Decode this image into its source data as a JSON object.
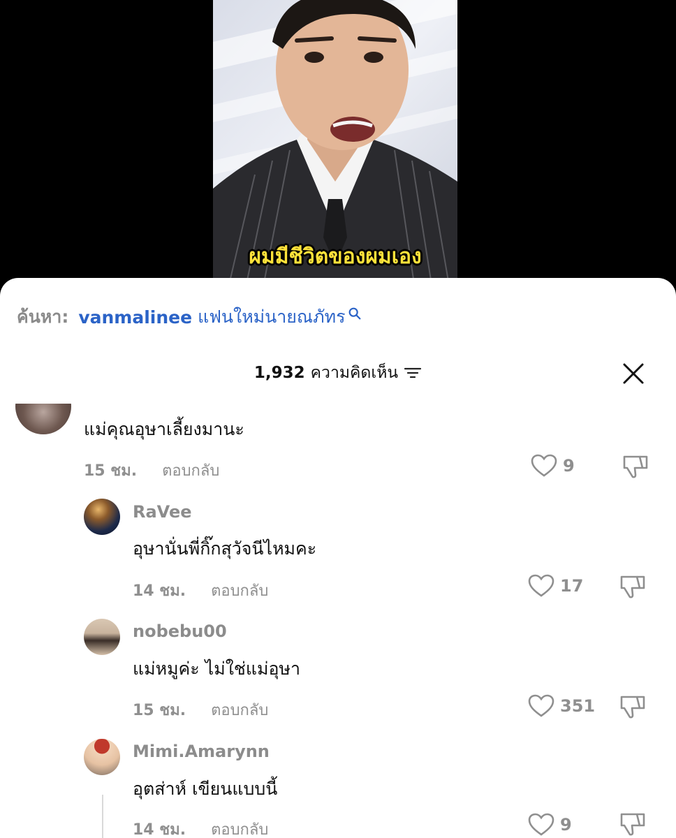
{
  "video": {
    "caption": "ผมมีชีวิตของผมเอง"
  },
  "search": {
    "prefix": "ค้นหา:",
    "term": "vanmalinee",
    "term_rest": "แฟนใหม่นายณภัทร"
  },
  "header": {
    "comment_count": "1,932",
    "comment_label": "ความคิดเห็น"
  },
  "comments": [
    {
      "username": "",
      "text": "แม่คุณอุษาเลี้ยงมานะ",
      "time": "15 ชม.",
      "reply_label": "ตอบกลับ",
      "likes": "9"
    },
    {
      "username": "RaVee",
      "text": "อุษานั่นพี่กิ๊กสุวัจนีไหมคะ",
      "time": "14 ชม.",
      "reply_label": "ตอบกลับ",
      "likes": "17"
    },
    {
      "username": "nobebu00",
      "text": "แม่หมูค่ะ ไม่ใช่แม่อุษา",
      "time": "15 ชม.",
      "reply_label": "ตอบกลับ",
      "likes": "351"
    },
    {
      "username": "Mimi.Amarynn",
      "text": "อุตส่าห์ เขียนแบบนี้",
      "time": "14 ชม.",
      "reply_label": "ตอบกลับ",
      "likes": "9"
    }
  ],
  "colors": {
    "link_blue": "#2b63c7",
    "caption_yellow": "#ffe23a",
    "muted_gray": "#8f8f8f"
  }
}
